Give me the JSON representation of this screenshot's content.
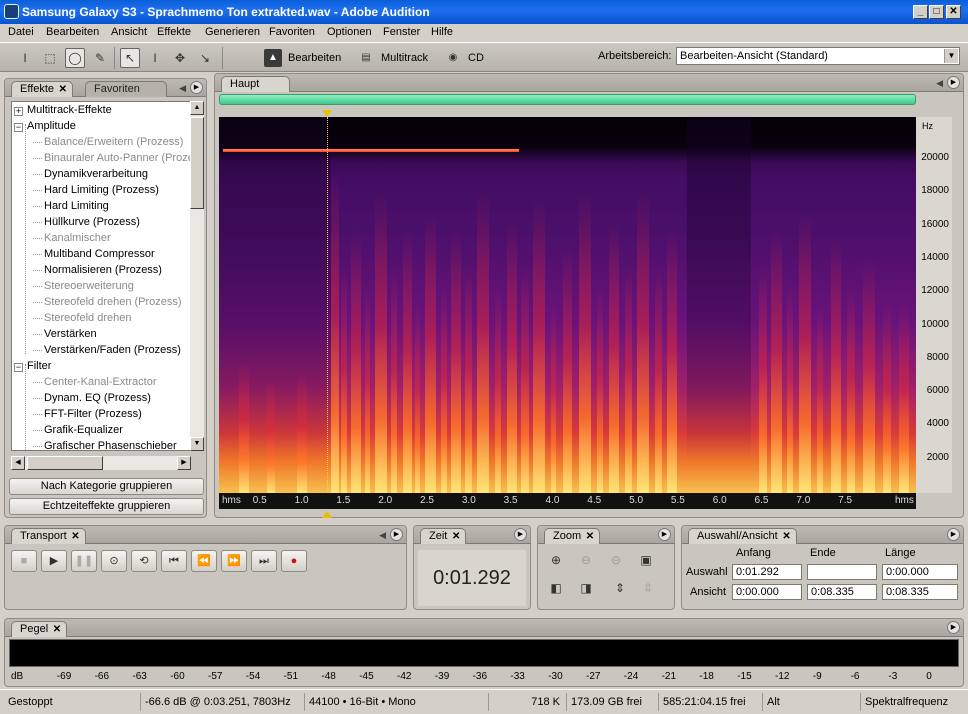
{
  "window": {
    "title": "Samsung Galaxy S3 - Sprachmemo Ton extrakted.wav - Adobe Audition"
  },
  "menu": [
    "Datei",
    "Bearbeiten",
    "Ansicht",
    "Effekte",
    "Generieren",
    "Favoriten",
    "Optionen",
    "Fenster",
    "Hilfe"
  ],
  "toolbar": {
    "modes": [
      {
        "label": "Bearbeiten"
      },
      {
        "label": "Multitrack"
      },
      {
        "label": "CD"
      }
    ],
    "workspace_label": "Arbeitsbereich:",
    "workspace_value": "Bearbeiten-Ansicht (Standard)"
  },
  "effects_panel": {
    "tabs": [
      "Effekte",
      "Favoriten"
    ],
    "tree": [
      {
        "label": "Multitrack-Effekte",
        "type": "cat",
        "expanded": false
      },
      {
        "label": "Amplitude",
        "type": "cat",
        "expanded": true
      },
      {
        "label": "Balance/Erweitern (Prozess)",
        "type": "item",
        "dim": true
      },
      {
        "label": "Binauraler Auto-Panner (Prozess)",
        "type": "item",
        "dim": true
      },
      {
        "label": "Dynamikverarbeitung",
        "type": "item",
        "dim": false
      },
      {
        "label": "Hard Limiting (Prozess)",
        "type": "item",
        "dim": false
      },
      {
        "label": "Hard Limiting",
        "type": "item",
        "dim": false
      },
      {
        "label": "Hüllkurve (Prozess)",
        "type": "item",
        "dim": false
      },
      {
        "label": "Kanalmischer",
        "type": "item",
        "dim": true
      },
      {
        "label": "Multiband Compressor",
        "type": "item",
        "dim": false
      },
      {
        "label": "Normalisieren (Prozess)",
        "type": "item",
        "dim": false
      },
      {
        "label": "Stereoerweiterung",
        "type": "item",
        "dim": true
      },
      {
        "label": "Stereofeld drehen (Prozess)",
        "type": "item",
        "dim": true
      },
      {
        "label": "Stereofeld drehen",
        "type": "item",
        "dim": true
      },
      {
        "label": "Verstärken",
        "type": "item",
        "dim": false
      },
      {
        "label": "Verstärken/Faden (Prozess)",
        "type": "item",
        "dim": false
      },
      {
        "label": "Filter",
        "type": "cat",
        "expanded": true
      },
      {
        "label": "Center-Kanal-Extractor",
        "type": "item",
        "dim": true
      },
      {
        "label": "Dynam. EQ (Prozess)",
        "type": "item",
        "dim": false
      },
      {
        "label": "FFT-Filter (Prozess)",
        "type": "item",
        "dim": false
      },
      {
        "label": "Grafik-Equalizer",
        "type": "item",
        "dim": false
      },
      {
        "label": "Grafischer Phasenschieber",
        "type": "item",
        "dim": false
      }
    ],
    "group_by_category": "Nach Kategorie gruppieren",
    "group_realtime": "Echtzeiteffekte gruppieren"
  },
  "editor": {
    "tab": "Haupt",
    "hz_unit": "Hz",
    "hz_labels": [
      "20000",
      "18000",
      "16000",
      "14000",
      "12000",
      "10000",
      "8000",
      "6000",
      "4000",
      "2000"
    ],
    "time_unit": "hms",
    "time_labels": [
      "0.5",
      "1.0",
      "1.5",
      "2.0",
      "2.5",
      "3.0",
      "3.5",
      "4.0",
      "4.5",
      "5.0",
      "5.5",
      "6.0",
      "6.5",
      "7.0",
      "7.5"
    ],
    "playhead_seconds": 1.292,
    "total_seconds": 8.335
  },
  "transport": {
    "tab": "Transport"
  },
  "time_panel": {
    "tab": "Zeit",
    "value": "0:01.292"
  },
  "zoom_panel": {
    "tab": "Zoom"
  },
  "selection_panel": {
    "tab": "Auswahl/Ansicht",
    "headers": [
      "Anfang",
      "Ende",
      "Länge"
    ],
    "rows": [
      {
        "label": "Auswahl",
        "start": "0:01.292",
        "end": "",
        "length": "0:00.000"
      },
      {
        "label": "Ansicht",
        "start": "0:00.000",
        "end": "0:08.335",
        "length": "0:08.335"
      }
    ]
  },
  "level_panel": {
    "tab": "Pegel",
    "scale": [
      "dB",
      "-69",
      "-66",
      "-63",
      "-60",
      "-57",
      "-54",
      "-51",
      "-48",
      "-45",
      "-42",
      "-39",
      "-36",
      "-33",
      "-30",
      "-27",
      "-24",
      "-21",
      "-18",
      "-15",
      "-12",
      "-9",
      "-6",
      "-3",
      "0"
    ]
  },
  "status": {
    "state": "Gestoppt",
    "cursor": "-66.6 dB @  0:03.251, 7803Hz",
    "format": "44100 • 16-Bit • Mono",
    "size": "718 K",
    "free": "173.09 GB frei",
    "free_time": "585:21:04.15 frei",
    "key": "Alt",
    "view": "Spektralfrequenz"
  }
}
